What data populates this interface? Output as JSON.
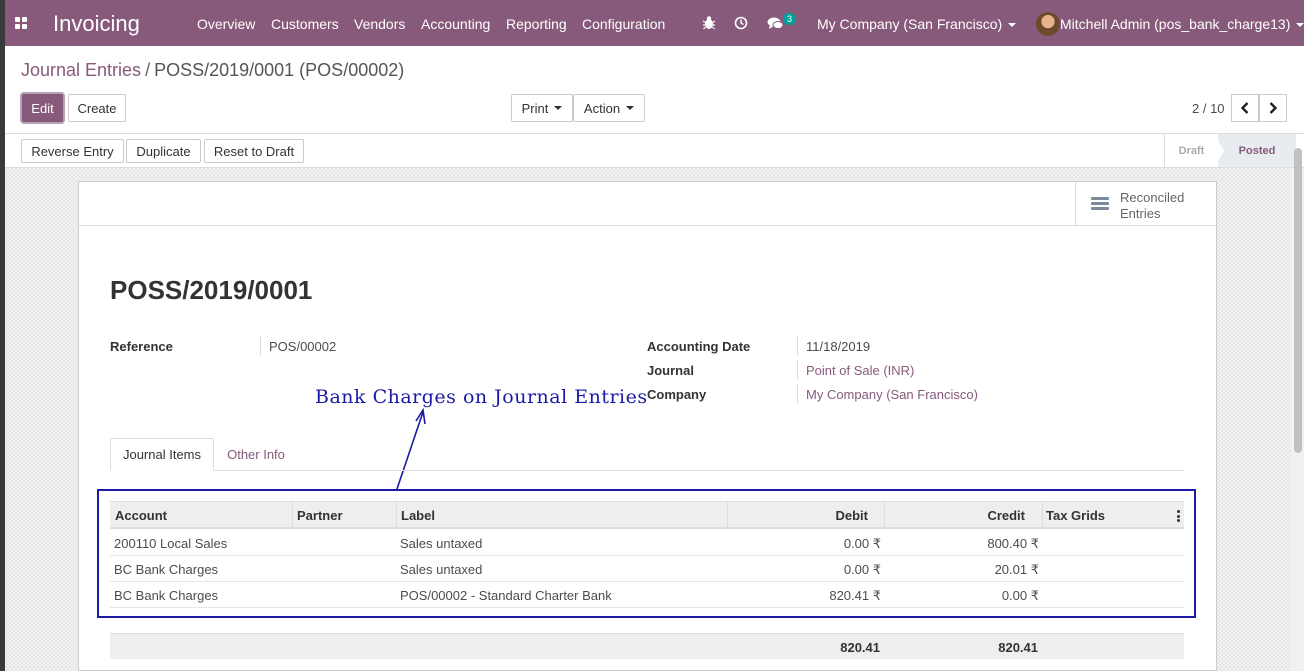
{
  "navbar": {
    "app_name": "Invoicing",
    "menus": [
      "Overview",
      "Customers",
      "Vendors",
      "Accounting",
      "Reporting",
      "Configuration"
    ],
    "messages_count": "3",
    "company": "My Company (San Francisco)",
    "user": "Mitchell Admin (pos_bank_charge13)",
    "colors": {
      "brand": "#875a7b",
      "badge": "#00a09d"
    },
    "icons": [
      "apps-grid-icon",
      "bug-icon",
      "clock-icon",
      "chat-icon"
    ]
  },
  "breadcrumb": {
    "parent": "Journal Entries",
    "current": "POSS/2019/0001 (POS/00002)"
  },
  "buttons": {
    "edit": "Edit",
    "create": "Create",
    "print": "Print",
    "action": "Action"
  },
  "pager": {
    "value": "2 / 10"
  },
  "statusbar": {
    "buttons": [
      "Reverse Entry",
      "Duplicate",
      "Reset to Draft"
    ],
    "stages": [
      "Draft",
      "Posted"
    ],
    "active_stage": "Posted"
  },
  "smart_button": {
    "label_line1": "Reconciled",
    "label_line2": "Entries"
  },
  "record": {
    "name": "POSS/2019/0001",
    "reference_label": "Reference",
    "reference": "POS/00002",
    "date_label": "Accounting Date",
    "date": "11/18/2019",
    "journal_label": "Journal",
    "journal": "Point of Sale (INR)",
    "company_label": "Company",
    "company": "My Company (San Francisco)"
  },
  "annotation": {
    "text": "Bank Charges on Journal Entries",
    "color": "#1a1aa6"
  },
  "tabs": [
    "Journal Items",
    "Other Info"
  ],
  "table": {
    "headers": [
      "Account",
      "Partner",
      "Label",
      "Debit",
      "Credit",
      "Tax Grids"
    ],
    "rows": [
      {
        "account": "200110 Local Sales",
        "partner": "",
        "label": "Sales untaxed",
        "debit": "0.00 ₹",
        "credit": "800.40 ₹"
      },
      {
        "account": "BC Bank Charges",
        "partner": "",
        "label": "Sales untaxed",
        "debit": "0.00 ₹",
        "credit": "20.01 ₹"
      },
      {
        "account": "BC Bank Charges",
        "partner": "",
        "label": "POS/00002 - Standard Charter Bank",
        "debit": "820.41 ₹",
        "credit": "0.00 ₹"
      }
    ],
    "totals": {
      "debit": "820.41",
      "credit": "820.41"
    }
  }
}
